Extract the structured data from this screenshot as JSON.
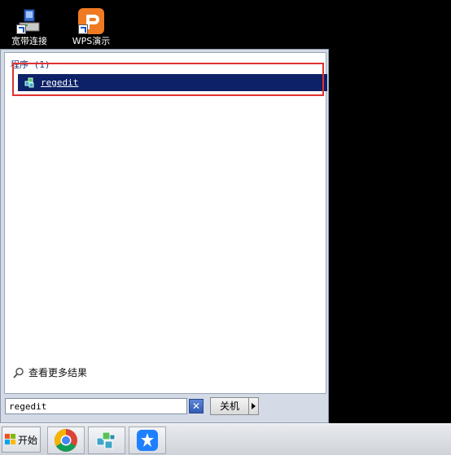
{
  "desktop": {
    "icons": [
      {
        "label": "宽带连接",
        "icon": "broadband-connection-icon"
      },
      {
        "label": "WPS演示",
        "icon": "wps-presentation-icon"
      }
    ]
  },
  "start_menu": {
    "category_header": "程序 (1)",
    "results": [
      {
        "label": "regedit",
        "icon": "regedit-icon",
        "selected": true
      }
    ],
    "see_more_label": "查看更多结果",
    "search_value": "regedit",
    "clear_icon": "clear-search-icon",
    "shutdown_label": "关机",
    "highlight_color": "#e03131",
    "selection_color": "#0c2167"
  },
  "taskbar": {
    "start_label": "开始",
    "items": [
      {
        "icon": "chrome-icon"
      },
      {
        "icon": "registry-editor-icon"
      },
      {
        "icon": "lark-icon"
      }
    ]
  }
}
